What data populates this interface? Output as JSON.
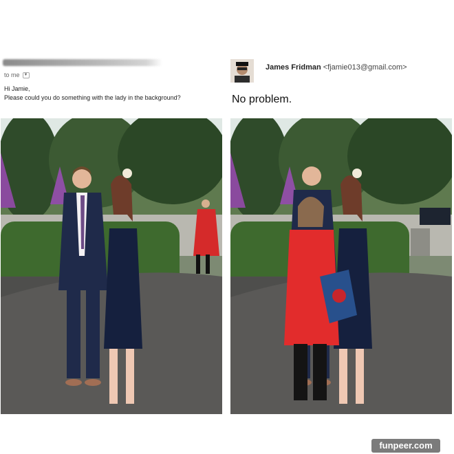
{
  "original_email": {
    "to_label": "to me",
    "greeting": "Hi Jamie,",
    "request": "Please could you do something with the lady in the background?"
  },
  "reply_email": {
    "sender_name": "James Fridman",
    "sender_email": "<fjamie013@gmail.com>",
    "body": "No problem.",
    "avatar_icon": "sender-avatar-icon"
  },
  "photos": {
    "left_icon": "original-wedding-photo",
    "right_icon": "edited-wedding-photo"
  },
  "watermark": "funpeer.com"
}
